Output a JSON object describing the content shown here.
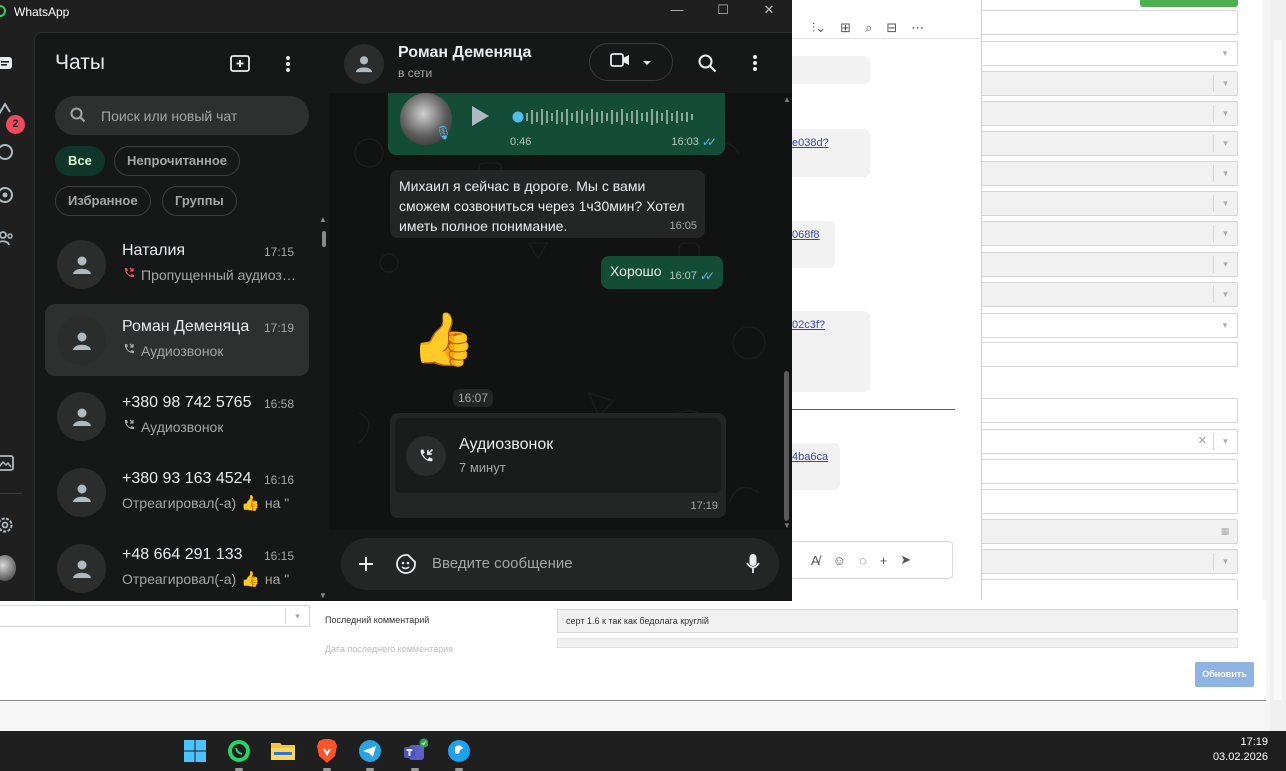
{
  "window": {
    "title": "WhatsApp"
  },
  "rail": {
    "unread_badge": "2"
  },
  "chat_list": {
    "title": "Чаты",
    "search_placeholder": "Поиск или новый чат",
    "filters": [
      "Все",
      "Непрочитанное",
      "Избранное",
      "Группы"
    ],
    "chats": [
      {
        "name": "Наталия",
        "time": "17:15",
        "preview": "Пропущенный аудиозвонок",
        "preview_icon": "missed-call-icon",
        "selected": false
      },
      {
        "name": "Роман Деменяца",
        "time": "17:19",
        "preview": "Аудиозвонок",
        "preview_icon": "call-icon",
        "selected": true
      },
      {
        "name": "+380 98 742 5765",
        "time": "16:58",
        "preview": "Аудиозвонок",
        "preview_icon": "call-icon",
        "selected": false
      },
      {
        "name": "+380 93 163 4524",
        "time": "16:16",
        "preview": "Отреагировал(-а)",
        "preview_suffix": "на \"",
        "preview_icon": "thumbs-up-emoji",
        "selected": false
      },
      {
        "name": "+48 664 291 133",
        "time": "16:15",
        "preview": "Отреагировал(-а)",
        "preview_suffix": "на \"",
        "preview_icon": "thumbs-up-emoji",
        "selected": false
      }
    ]
  },
  "conversation": {
    "contact_name": "Роман Деменяца",
    "status": "в сети",
    "messages": [
      {
        "type": "voice",
        "direction": "out",
        "duration": "0:46",
        "time": "16:03"
      },
      {
        "type": "text",
        "direction": "in",
        "text": "Михаил я сейчас в дороге. Мы с вами сможем созвониться через 1ч30мин? Хотел иметь полное понимание.",
        "time": "16:05"
      },
      {
        "type": "text",
        "direction": "out",
        "text": "Хорошо",
        "time": "16:07"
      },
      {
        "type": "sticker",
        "direction": "in",
        "emoji": "👍",
        "time": "16:07"
      },
      {
        "type": "call",
        "direction": "in",
        "title": "Аудиозвонок",
        "subtitle": "7 минут",
        "time": "17:19"
      }
    ],
    "composer_placeholder": "Введите сообщение"
  },
  "background_app": {
    "links": [
      "e038d?",
      "068f8",
      "02c3f?",
      "4ba6ca"
    ],
    "last_comment_label": "Последний комментарий",
    "last_comment_value": "серт 1.6 к так как бедолага круглій",
    "last_comment_date_label": "Дата последнего комментария",
    "update_button": "Обновить"
  },
  "taskbar": {
    "apps": [
      "windows-start",
      "whatsapp",
      "file-explorer",
      "brave",
      "telegram",
      "teams",
      "skype"
    ],
    "time": "17:19",
    "date": "03.02.2026"
  },
  "colors": {
    "accent_green": "#25d366",
    "outgoing_bubble": "#144d37",
    "incoming_bubble": "#242626",
    "badge_red": "#ea4b5e",
    "read_tick": "#53bdeb"
  }
}
